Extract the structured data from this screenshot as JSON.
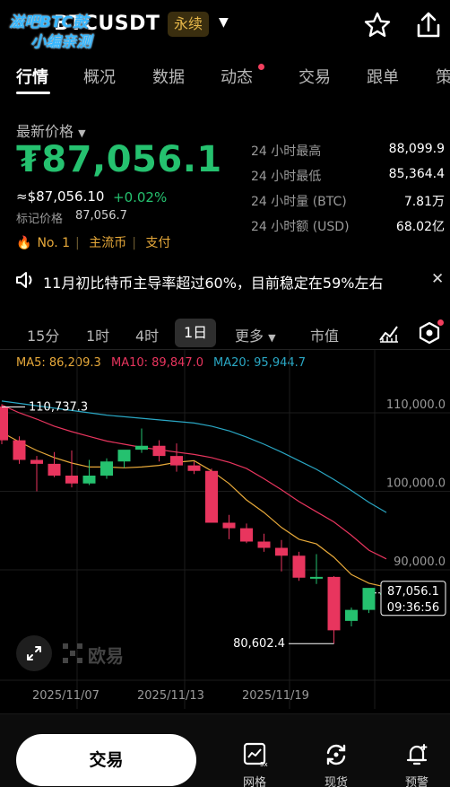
{
  "header": {
    "pair": "BTCUSDT",
    "type_badge": "永续",
    "watermark_line1": "滋吧BTC鼓",
    "watermark_line2": "小编亲测"
  },
  "tabs": [
    "行情",
    "概况",
    "数据",
    "动态",
    "交易",
    "跟单",
    "策"
  ],
  "price": {
    "label": "最新价格",
    "main": "₮87,056.1",
    "usd": "≈$87,056.10",
    "change": "+0.02%",
    "mark_label": "标记价格",
    "mark_value": "87,056.7",
    "tags": [
      "No. 1",
      "主流币",
      "支付"
    ]
  },
  "stats": [
    {
      "label": "24 小时最高",
      "value": "88,099.9"
    },
    {
      "label": "24 小时最低",
      "value": "85,364.4"
    },
    {
      "label": "24 小时量 (BTC)",
      "value": "7.81万"
    },
    {
      "label": "24 小时额 (USD)",
      "value": "68.02亿"
    }
  ],
  "notice": {
    "text": "11月初比特币主导率超过60%，目前稳定在59%左右"
  },
  "chart_tabs": [
    "15分",
    "1时",
    "4时",
    "1日",
    "更多",
    "市值"
  ],
  "ma": {
    "ma5": "MA5: 86,209.3",
    "ma10": "MA10: 89,847.0",
    "ma20": "MA20: 95,944.7"
  },
  "colors": {
    "up": "#25c16f",
    "down": "#e8355e",
    "ma5": "#e7a93a",
    "ma10": "#e8355e",
    "ma20": "#2aa7c4"
  },
  "chart_data": {
    "type": "candlestick",
    "y_ticks": [
      "110,000.0",
      "100,000.0",
      "90,000.0"
    ],
    "y_tick_values": [
      110000,
      100000,
      90000
    ],
    "x_ticks": [
      "2025/11/07",
      "2025/11/13",
      "2025/11/19"
    ],
    "high_label": "110,737.3",
    "low_label": "80,602.4",
    "last_price": "87,056.1",
    "countdown": "09:36:56",
    "candles": [
      {
        "o": 110800,
        "h": 111100,
        "c": 106500,
        "l": 106000
      },
      {
        "o": 106500,
        "h": 107000,
        "c": 104000,
        "l": 103500
      },
      {
        "o": 104000,
        "h": 104500,
        "c": 103500,
        "l": 100000
      },
      {
        "o": 103500,
        "h": 105000,
        "c": 102000,
        "l": 101800
      },
      {
        "o": 102000,
        "h": 105200,
        "c": 101000,
        "l": 100500
      },
      {
        "o": 101000,
        "h": 104000,
        "c": 102000,
        "l": 100800
      },
      {
        "o": 102000,
        "h": 104200,
        "c": 103800,
        "l": 101600
      },
      {
        "o": 103800,
        "h": 105200,
        "c": 105300,
        "l": 103000
      },
      {
        "o": 105300,
        "h": 108000,
        "c": 105800,
        "l": 104900
      },
      {
        "o": 105800,
        "h": 106500,
        "c": 104500,
        "l": 103800
      },
      {
        "o": 104500,
        "h": 106100,
        "c": 103300,
        "l": 102500
      },
      {
        "o": 103300,
        "h": 103800,
        "c": 102600,
        "l": 102200
      },
      {
        "o": 102600,
        "h": 102900,
        "c": 96000,
        "l": 96000
      },
      {
        "o": 96000,
        "h": 97000,
        "c": 95300,
        "l": 93900
      },
      {
        "o": 95300,
        "h": 95900,
        "c": 93600,
        "l": 93400
      },
      {
        "o": 93600,
        "h": 94600,
        "c": 92800,
        "l": 92300
      },
      {
        "o": 92800,
        "h": 93800,
        "c": 91800,
        "l": 89800
      },
      {
        "o": 91800,
        "h": 92300,
        "c": 89000,
        "l": 88600
      },
      {
        "o": 89000,
        "h": 92000,
        "c": 89100,
        "l": 88200
      },
      {
        "o": 89100,
        "h": 89200,
        "c": 82300,
        "l": 80602
      },
      {
        "o": 83500,
        "h": 85200,
        "c": 84900,
        "l": 82800
      },
      {
        "o": 84900,
        "h": 87600,
        "c": 87700,
        "l": 84500
      },
      {
        "o": 87000,
        "h": 88100,
        "c": 87056,
        "l": 86800
      }
    ],
    "ma5": [
      107500,
      106300,
      105200,
      104300,
      103600,
      103100,
      103100,
      103000,
      103100,
      103300,
      103700,
      103900,
      102600,
      101000,
      98900,
      97300,
      95400,
      93900,
      93300,
      91600,
      89400,
      88300,
      87800
    ],
    "ma10": [
      111000,
      110000,
      109200,
      108300,
      107600,
      107000,
      106400,
      106000,
      105600,
      105300,
      105000,
      104700,
      104300,
      103700,
      102900,
      101600,
      100200,
      98700,
      97400,
      96100,
      94400,
      92500,
      91400
    ],
    "ma20": [
      111500,
      111200,
      110900,
      110600,
      110300,
      110000,
      109700,
      109500,
      109300,
      109100,
      108900,
      108700,
      108300,
      107700,
      106900,
      106000,
      105000,
      103900,
      102800,
      101500,
      100100,
      98600,
      97300
    ]
  },
  "brand": "欧易",
  "bottom": {
    "trade": "交易",
    "nav": [
      "网格",
      "现货",
      "预警"
    ],
    "grid_badge": "5x"
  }
}
